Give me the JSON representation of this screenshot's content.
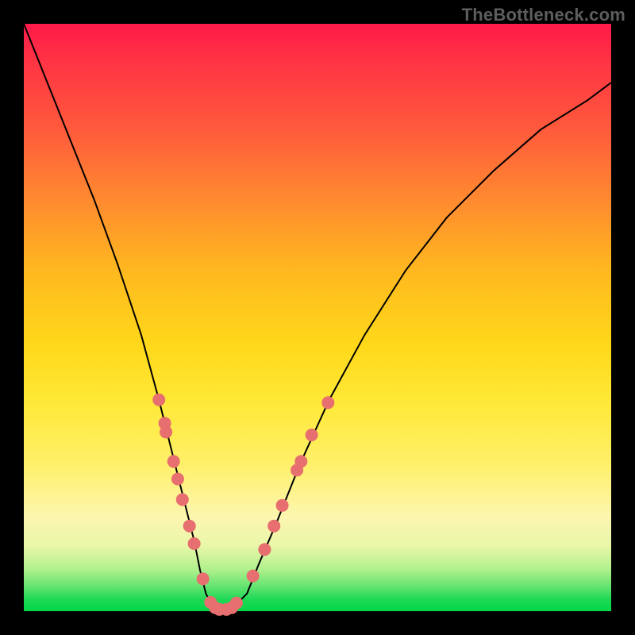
{
  "watermark": "TheBottleneck.com",
  "colors": {
    "dot": "#e76f6f",
    "curve": "#000000"
  },
  "chart_data": {
    "type": "line",
    "title": "",
    "xlabel": "",
    "ylabel": "",
    "xlim": [
      0,
      100
    ],
    "ylim": [
      0,
      100
    ],
    "grid": false,
    "legend": null,
    "series": [
      {
        "name": "bottleneck-curve",
        "x": [
          0,
          4,
          8,
          12,
          16,
          20,
          23,
          25,
          27,
          29,
          30,
          31,
          32,
          33,
          34,
          35,
          36,
          38,
          40,
          43,
          47,
          52,
          58,
          65,
          72,
          80,
          88,
          96,
          100
        ],
        "y": [
          100,
          90,
          80,
          70,
          59,
          47,
          36,
          28,
          20,
          12,
          7,
          3,
          1,
          0,
          0,
          0,
          1,
          3,
          8,
          15,
          25,
          36,
          47,
          58,
          67,
          75,
          82,
          87,
          90
        ]
      }
    ],
    "scatter": {
      "name": "highlight-dots",
      "points": [
        {
          "x": 23.0,
          "y": 36.0
        },
        {
          "x": 24.0,
          "y": 32.0
        },
        {
          "x": 24.2,
          "y": 30.5
        },
        {
          "x": 25.5,
          "y": 25.5
        },
        {
          "x": 26.2,
          "y": 22.5
        },
        {
          "x": 27.0,
          "y": 19.0
        },
        {
          "x": 28.2,
          "y": 14.5
        },
        {
          "x": 29.0,
          "y": 11.5
        },
        {
          "x": 30.5,
          "y": 5.5
        },
        {
          "x": 31.8,
          "y": 1.5
        },
        {
          "x": 32.6,
          "y": 0.6
        },
        {
          "x": 33.3,
          "y": 0.3
        },
        {
          "x": 34.5,
          "y": 0.3
        },
        {
          "x": 35.4,
          "y": 0.6
        },
        {
          "x": 36.2,
          "y": 1.4
        },
        {
          "x": 39.0,
          "y": 6.0
        },
        {
          "x": 41.0,
          "y": 10.5
        },
        {
          "x": 42.6,
          "y": 14.5
        },
        {
          "x": 44.0,
          "y": 18.0
        },
        {
          "x": 46.5,
          "y": 24.0
        },
        {
          "x": 47.2,
          "y": 25.5
        },
        {
          "x": 49.0,
          "y": 30.0
        },
        {
          "x": 51.8,
          "y": 35.5
        }
      ]
    }
  }
}
